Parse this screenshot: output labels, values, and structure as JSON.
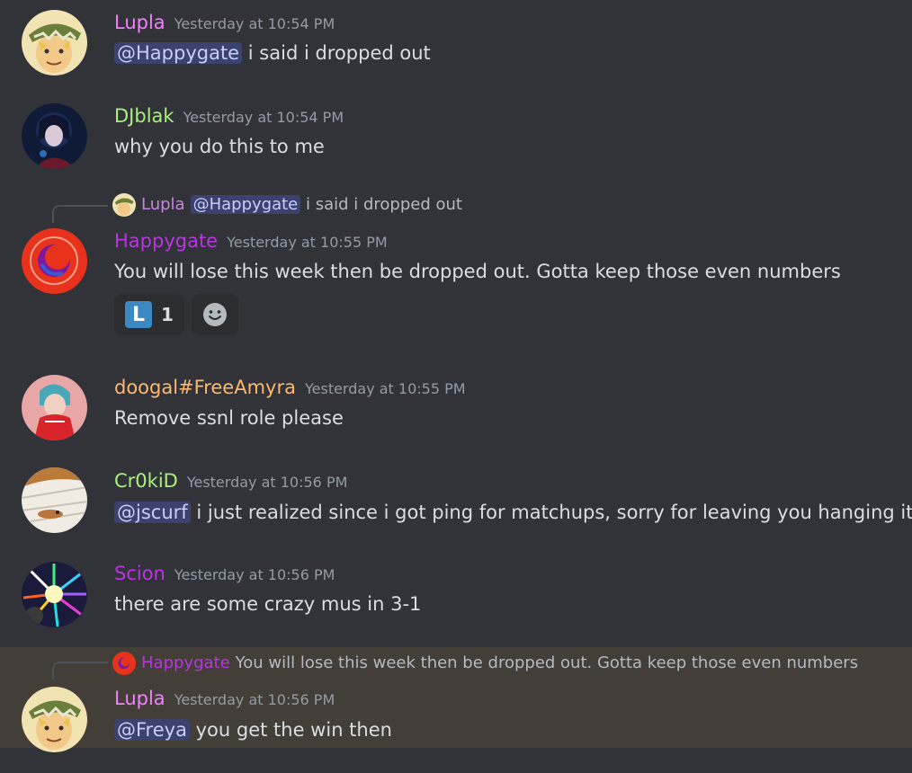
{
  "messages": [
    {
      "username": "Lupla",
      "color": "#f47fff",
      "timestamp": "Yesterday at 10:54 PM",
      "mention": "@Happygate",
      "text": " i said i dropped out"
    },
    {
      "username": "DJblak",
      "color": "#a9f07c",
      "timestamp": "Yesterday at 10:54 PM",
      "text": "why you do this to me"
    },
    {
      "username": "Happygate",
      "color": "#b935e0",
      "timestamp": "Yesterday at 10:55 PM",
      "text": "You will lose this week then be dropped out. Gotta keep those even numbers",
      "reply": {
        "username": "Lupla",
        "mention": "@Happygate",
        "text": " i said i dropped out"
      },
      "reaction": {
        "emoji": "L",
        "count": "1"
      }
    },
    {
      "username": "doogal#FreeAmyra",
      "color": "#ffb86c",
      "timestamp": "Yesterday at 10:55 PM",
      "text": "Remove ssnl role please"
    },
    {
      "username": "Cr0kiD",
      "color": "#a9f07c",
      "timestamp": "Yesterday at 10:56 PM",
      "mention": "@jscurf",
      "text": " i just realized since i got ping for matchups, sorry for leaving you hanging it"
    },
    {
      "username": "Scion",
      "color": "#b935e0",
      "timestamp": "Yesterday at 10:56 PM",
      "text": "there are some crazy mus in 3-1"
    },
    {
      "username": "Lupla",
      "color": "#f47fff",
      "timestamp": "Yesterday at 10:56 PM",
      "mention": "@Freya",
      "text": " you get the win then",
      "reply": {
        "username": "Happygate",
        "text": "You will lose this week then be dropped out. Gotta keep those even numbers"
      }
    }
  ],
  "icons": {
    "add_reaction": "smiley-face-icon"
  }
}
